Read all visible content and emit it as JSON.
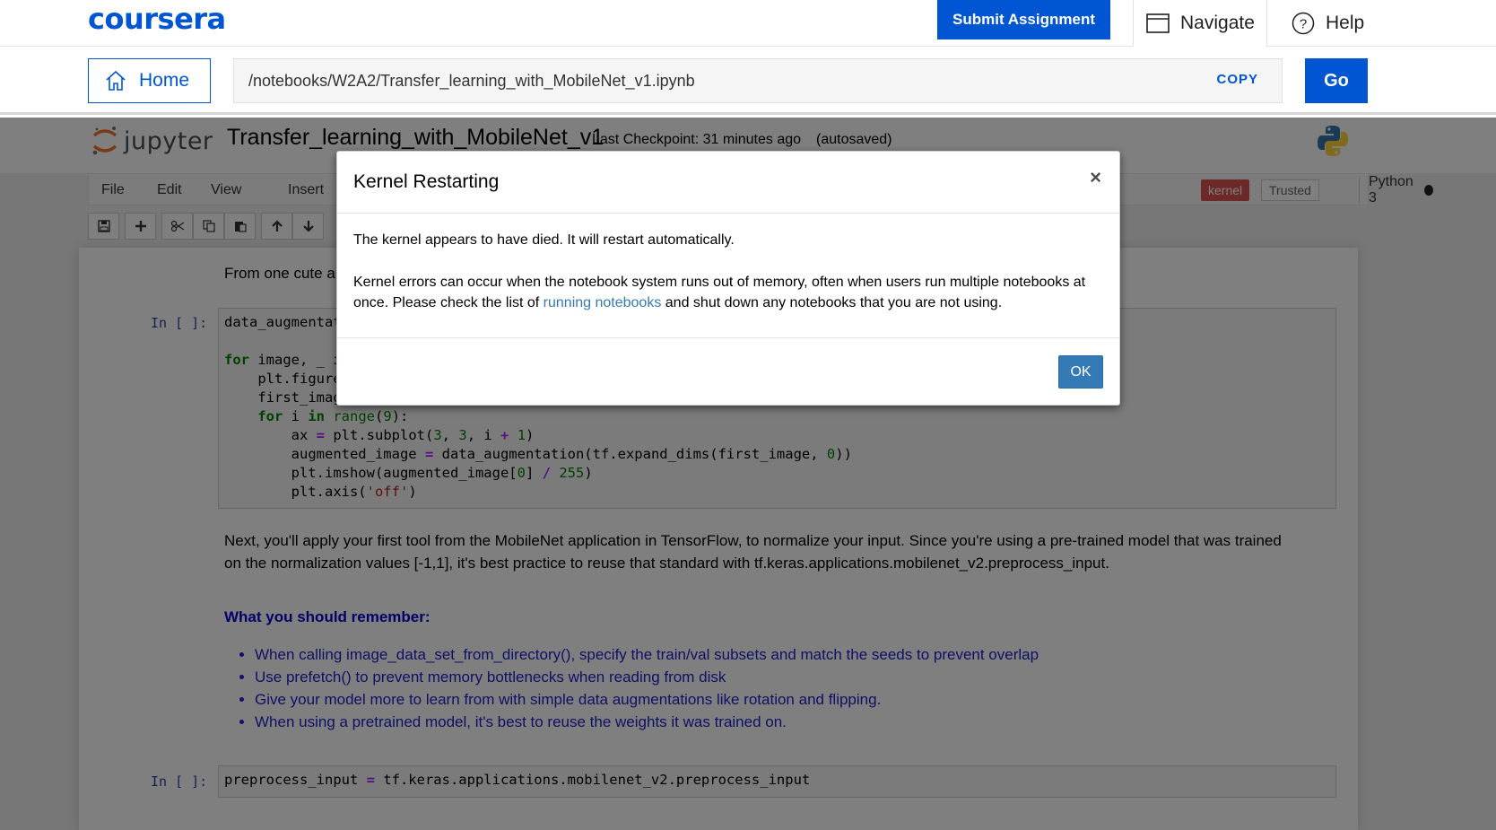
{
  "coursera": {
    "logo": "coursera",
    "submit_label": "Submit Assignment",
    "navigate_label": "Navigate",
    "help_label": "Help",
    "home_label": "Home",
    "url": "/notebooks/W2A2/Transfer_learning_with_MobileNet_v1.ipynb",
    "copy_label": "COPY",
    "go_label": "Go"
  },
  "jupyter": {
    "logo_text": "jupyter",
    "notebook_title": "Transfer_learning_with_MobileNet_v1",
    "checkpoint": "Last Checkpoint: 31 minutes ago",
    "autosave": "(autosaved)",
    "menu": [
      "File",
      "Edit",
      "View",
      "Insert"
    ],
    "kernel_badge": "kernel",
    "trusted_badge": "Trusted",
    "kernel_name": "Python 3",
    "brand_colors": {
      "coursera_blue": "#0056d2",
      "kernel_dead": "#d9534f"
    }
  },
  "notebook": {
    "md1": "From one cute a",
    "prompt1": "In [ ]:",
    "prompt2": "In [ ]:",
    "md2_line1": "Next, you'll apply your first tool from the MobileNet application in TensorFlow, to normalize your input. Since you're using a pre-trained model that was trained",
    "md2_line2": "on the normalization values [-1,1], it's best practice to reuse that standard with tf.keras.applications.mobilenet_v2.preprocess_input.",
    "remember_title": "What you should remember:",
    "remember_items": [
      "When calling image_data_set_from_directory(), specify the train/val subsets and match the seeds to prevent overlap",
      "Use prefetch() to prevent memory bottlenecks when reading from disk",
      "Give your model more to learn from with simple data augmentations like rotation and flipping.",
      "When using a pretrained model, it's best to reuse the weights it was trained on."
    ]
  },
  "modal": {
    "title": "Kernel Restarting",
    "close": "×",
    "body1": "The kernel appears to have died. It will restart automatically.",
    "body2_pre": "Kernel errors can occur when the notebook system runs out of memory, often when users run multiple notebooks at once. Please check the list of ",
    "body2_link": "running notebooks",
    "body2_post": " and shut down any notebooks that you are not using.",
    "ok_label": "OK"
  }
}
